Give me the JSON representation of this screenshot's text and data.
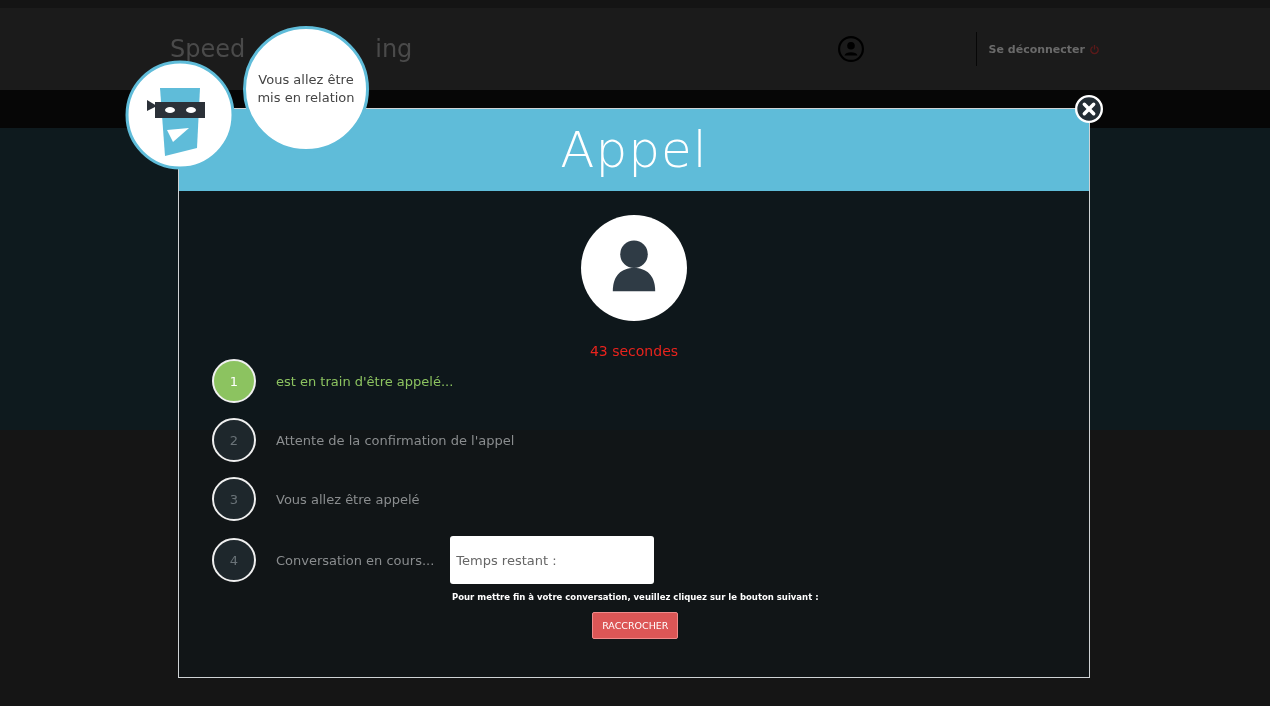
{
  "header": {
    "logo_parts": [
      "Speed",
      "ing"
    ],
    "logout": "Se déconnecter"
  },
  "mascot": {
    "bubble": "Vous allez être mis en relation"
  },
  "dialog": {
    "title": "Appel",
    "timer": "43 secondes",
    "steps": [
      {
        "number": "1",
        "label": "est en train d'être appelé...",
        "active": true
      },
      {
        "number": "2",
        "label": "Attente de la confirmation de l'appel",
        "active": false
      },
      {
        "number": "3",
        "label": "Vous allez être appelé",
        "active": false
      },
      {
        "number": "4",
        "label": "Conversation en cours...",
        "active": false
      }
    ],
    "remaining_label": "Temps restant :",
    "hangup_note": "Pour mettre fin à votre conversation, veuillez cliquez sur le bouton suivant :",
    "hangup_button": "RACCROCHER"
  }
}
